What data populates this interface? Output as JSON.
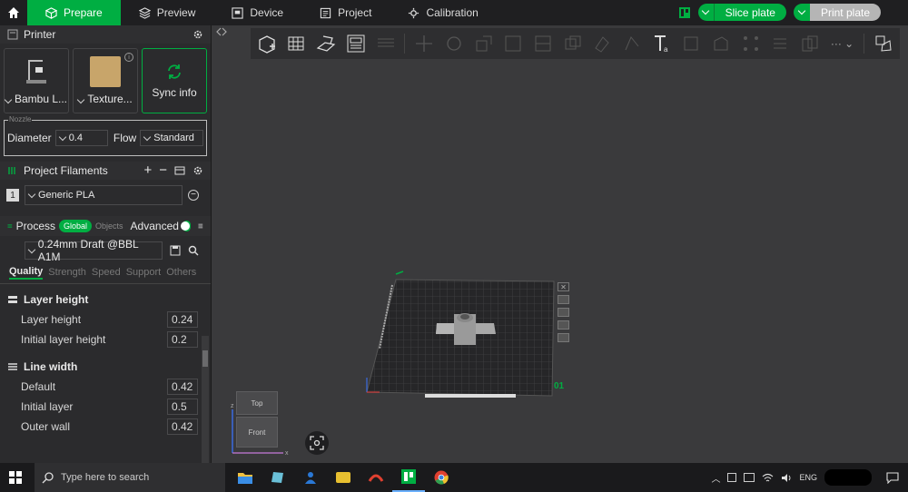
{
  "topbar": {
    "tabs": [
      {
        "label": "Prepare",
        "icon": "cube-icon",
        "active": true
      },
      {
        "label": "Preview",
        "icon": "layers-icon",
        "active": false
      },
      {
        "label": "Device",
        "icon": "device-icon",
        "active": false
      },
      {
        "label": "Project",
        "icon": "project-icon",
        "active": false
      },
      {
        "label": "Calibration",
        "icon": "calibration-icon",
        "active": false
      }
    ],
    "slice_label": "Slice plate",
    "print_label": "Print plate"
  },
  "printer": {
    "section_title": "Printer",
    "printer_name": "Bambu L...",
    "plate_name": "Texture...",
    "sync_label": "Sync info",
    "nozzle_legend": "Nozzle",
    "diameter_label": "Diameter",
    "diameter_value": "0.4",
    "flow_label": "Flow",
    "flow_value": "Standard"
  },
  "filaments": {
    "section_title": "Project Filaments",
    "slot": "1",
    "name": "Generic PLA"
  },
  "process": {
    "section_title": "Process",
    "global_label": "Global",
    "objects_label": "Objects",
    "advanced_label": "Advanced",
    "advanced_on": true,
    "preset": "0.24mm Draft @BBL A1M",
    "tabs": [
      "Quality",
      "Strength",
      "Speed",
      "Support",
      "Others"
    ],
    "active_tab": "Quality",
    "groups": [
      {
        "title": "Layer height",
        "params": [
          {
            "label": "Layer height",
            "value": "0.24"
          },
          {
            "label": "Initial layer height",
            "value": "0.2"
          }
        ]
      },
      {
        "title": "Line width",
        "params": [
          {
            "label": "Default",
            "value": "0.42"
          },
          {
            "label": "Initial layer",
            "value": "0.5"
          },
          {
            "label": "Outer wall",
            "value": "0.42"
          }
        ]
      }
    ]
  },
  "viewport": {
    "plate_id": "01",
    "cube_top": "Top",
    "cube_front": "Front"
  },
  "taskbar": {
    "search_placeholder": "Type here to search",
    "language": "ENG"
  },
  "colors": {
    "accent": "#00ae42",
    "background": "#3a3a3c",
    "panel": "#2b2b2d"
  }
}
